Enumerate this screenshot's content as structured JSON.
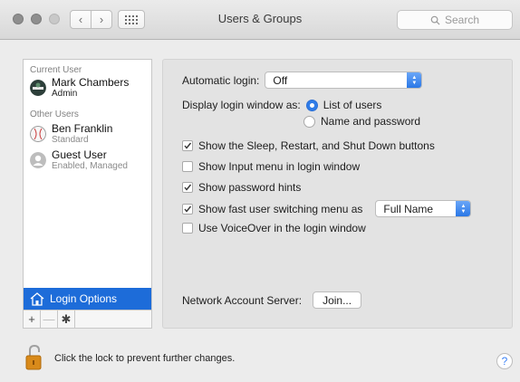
{
  "window": {
    "title": "Users & Groups"
  },
  "search": {
    "placeholder": "Search"
  },
  "sidebar": {
    "current_user_label": "Current User",
    "other_users_label": "Other Users",
    "users": [
      {
        "name": "Mark Chambers",
        "role": "Admin"
      },
      {
        "name": "Ben Franklin",
        "role": "Standard"
      },
      {
        "name": "Guest User",
        "role": "Enabled, Managed"
      }
    ],
    "login_options": "Login Options",
    "add": "+",
    "remove": "—",
    "action": "✱"
  },
  "panel": {
    "automatic_login_label": "Automatic login:",
    "automatic_login_value": "Off",
    "display_as_label": "Display login window as:",
    "radio_list": "List of users",
    "radio_name": "Name and password",
    "cb_sleep": "Show the Sleep, Restart, and Shut Down buttons",
    "cb_input": "Show Input menu in login window",
    "cb_hints": "Show password hints",
    "cb_fast": "Show fast user switching menu as",
    "fast_value": "Full Name",
    "cb_voiceover": "Use VoiceOver in the login window",
    "network_label": "Network Account Server:",
    "join_button": "Join..."
  },
  "footer": {
    "lock_text": "Click the lock to prevent further changes.",
    "help": "?"
  },
  "colors": {
    "selection": "#1d6cd9",
    "accent": "#2f7ce8"
  }
}
